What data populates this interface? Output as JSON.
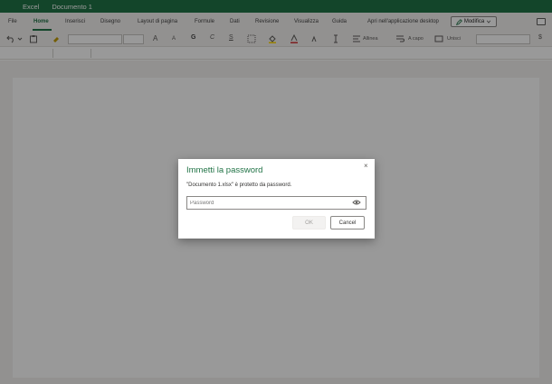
{
  "window": {
    "app_name": "Excel",
    "document_title": "Documento 1"
  },
  "ribbon": {
    "tabs": [
      {
        "label": "File"
      },
      {
        "label": "Home"
      },
      {
        "label": "Inserisci"
      },
      {
        "label": "Disegno"
      },
      {
        "label": "Layout di pagina"
      },
      {
        "label": "Formule"
      },
      {
        "label": "Dati"
      },
      {
        "label": "Revisione"
      },
      {
        "label": "Visualizza"
      },
      {
        "label": "Guida"
      }
    ],
    "active_tab": "Home",
    "open_desktop_label": "Apri nell'applicazione desktop",
    "edit_mode_label": "Modifica"
  },
  "toolbar": {
    "bold_label": "G",
    "italic_label": "C",
    "underline_label": "S",
    "font_grow_label": "A",
    "font_shrink_label": "A",
    "wrap_label": "A capo",
    "align_label": "Allinea",
    "merge_label": "Unisci",
    "currency_label": "$"
  },
  "dialog": {
    "title": "Immetti la password",
    "message": "\"Documento 1.xlsx\" è protetto da password.",
    "password_placeholder": "Password",
    "ok_label": "OK",
    "cancel_label": "Cancel",
    "close_glyph": "×"
  },
  "colors": {
    "brand": "#217346",
    "overlay": "rgba(0,0,0,0.40)"
  }
}
